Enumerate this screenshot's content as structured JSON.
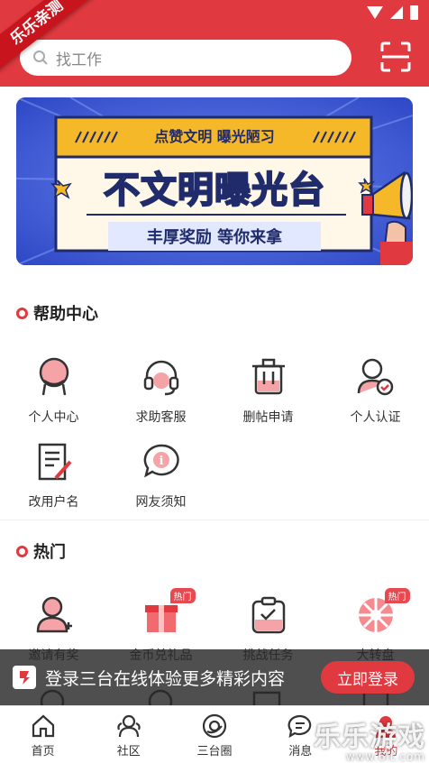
{
  "ribbon": "乐乐亲测",
  "search": {
    "placeholder": "找工作"
  },
  "banner": {
    "top_text": "点赞文明  曝光陋习",
    "headline": "不文明曝光台",
    "bottom_text": "丰厚奖励  等你来拿"
  },
  "help_center": {
    "title": "帮助中心",
    "items": [
      {
        "label": "个人中心",
        "icon": "person-icon"
      },
      {
        "label": "求助客服",
        "icon": "headset-icon"
      },
      {
        "label": "删帖申请",
        "icon": "trash-icon"
      },
      {
        "label": "个人认证",
        "icon": "verified-user-icon"
      },
      {
        "label": "改用户名",
        "icon": "edit-document-icon"
      },
      {
        "label": "网友须知",
        "icon": "info-bubble-icon"
      }
    ]
  },
  "hot": {
    "title": "热门",
    "badge": "热门",
    "items": [
      {
        "label": "邀请有奖",
        "icon": "invite-user-icon"
      },
      {
        "label": "金币兑礼品",
        "icon": "gift-icon"
      },
      {
        "label": "挑战任务",
        "icon": "task-icon"
      },
      {
        "label": "大转盘",
        "icon": "wheel-icon"
      }
    ]
  },
  "login_bar": {
    "text": "登录三台在线体验更多精彩内容",
    "button": "立即登录"
  },
  "nav": [
    {
      "label": "首页",
      "icon": "home-icon"
    },
    {
      "label": "社区",
      "icon": "community-icon"
    },
    {
      "label": "三台圈",
      "icon": "circle-icon"
    },
    {
      "label": "消息",
      "icon": "message-icon"
    },
    {
      "label": "我的",
      "icon": "me-icon"
    }
  ],
  "watermark": {
    "main": "乐乐游戏",
    "sub": "www.6lt.com"
  },
  "colors": {
    "brand": "#e0393f",
    "banner_blue": "#3a59d8",
    "banner_yellow": "#f5b829"
  }
}
